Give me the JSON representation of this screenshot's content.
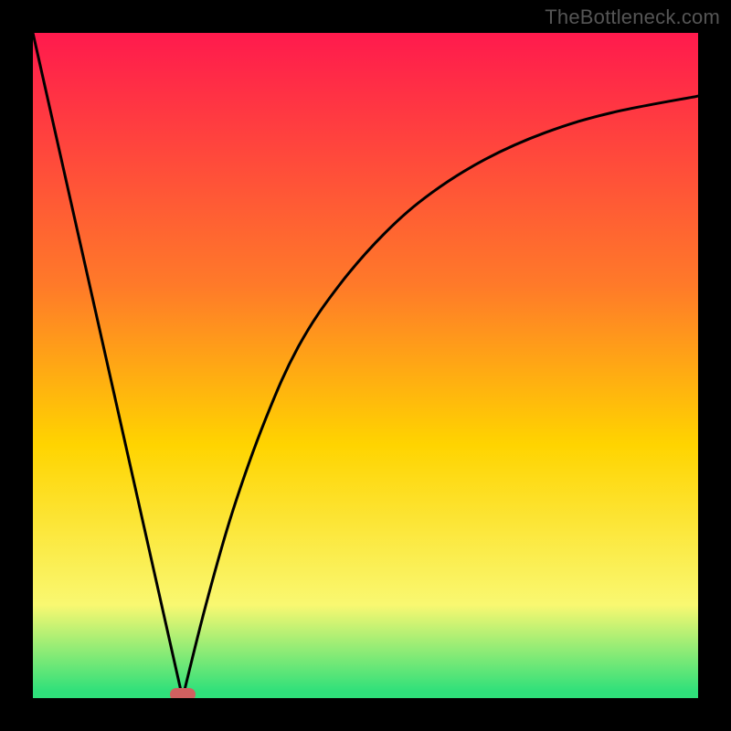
{
  "watermark": "TheBottleneck.com",
  "colors": {
    "bg": "#000000",
    "grad_top": "#ff1a4d",
    "grad_mid1": "#ff7a29",
    "grad_mid2": "#ffd400",
    "grad_mid3": "#f9f871",
    "grad_bot": "#2fe07a",
    "curve": "#000000",
    "marker": "#d06060"
  },
  "chart_data": {
    "type": "line",
    "title": "",
    "xlabel": "",
    "ylabel": "",
    "xlim": [
      0,
      1
    ],
    "ylim": [
      0,
      1
    ],
    "curve": {
      "left_line": {
        "x0": 0.0,
        "y0": 1.0,
        "x1": 0.225,
        "y1": 0.0
      },
      "right_curve_points": [
        {
          "x": 0.225,
          "y": 0.0
        },
        {
          "x": 0.26,
          "y": 0.14
        },
        {
          "x": 0.3,
          "y": 0.28
        },
        {
          "x": 0.35,
          "y": 0.42
        },
        {
          "x": 0.4,
          "y": 0.53
        },
        {
          "x": 0.46,
          "y": 0.62
        },
        {
          "x": 0.53,
          "y": 0.7
        },
        {
          "x": 0.6,
          "y": 0.76
        },
        {
          "x": 0.68,
          "y": 0.81
        },
        {
          "x": 0.77,
          "y": 0.85
        },
        {
          "x": 0.87,
          "y": 0.88
        },
        {
          "x": 1.0,
          "y": 0.905
        }
      ]
    },
    "marker": {
      "x": 0.225,
      "y": 0.005
    }
  }
}
